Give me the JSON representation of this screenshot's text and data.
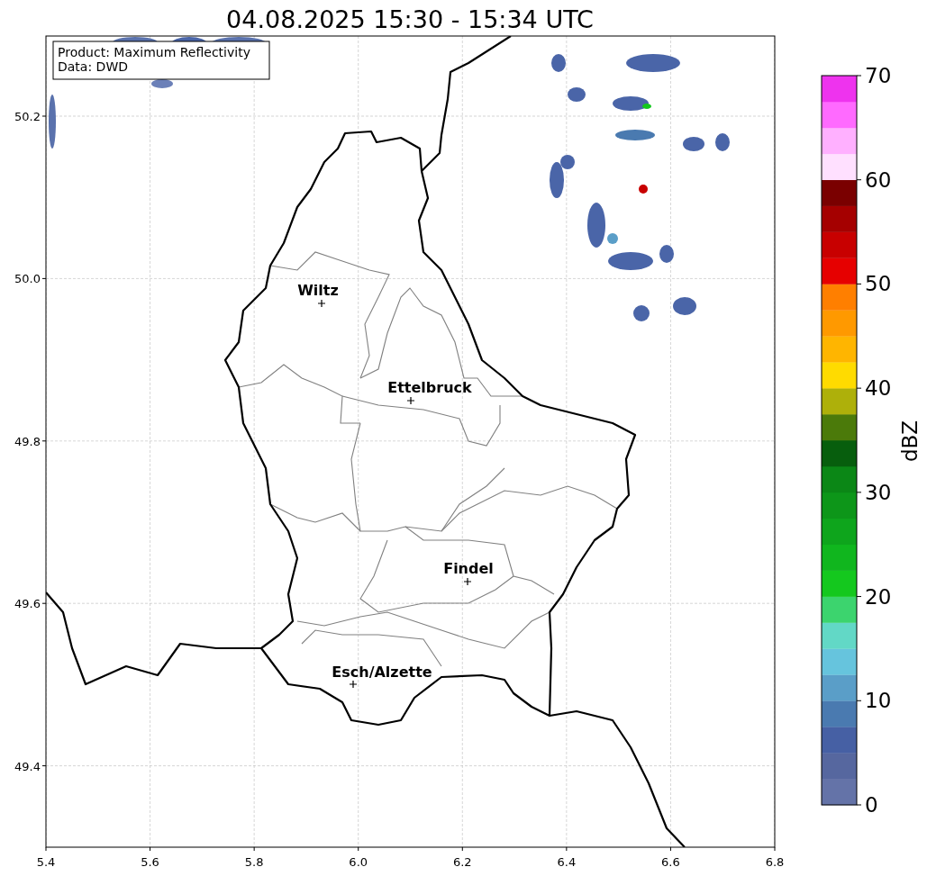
{
  "title": "04.08.2025 15:30 - 15:34 UTC",
  "info_box": [
    "Product: Maximum Reflectivity",
    "Data: DWD"
  ],
  "cities": [
    {
      "name": "Wiltz"
    },
    {
      "name": "Ettelbruck"
    },
    {
      "name": "Findel"
    },
    {
      "name": "Esch/Alzette"
    }
  ],
  "x_ticks": [
    "5.4",
    "5.6",
    "5.8",
    "6.0",
    "6.2",
    "6.4",
    "6.6",
    "6.8"
  ],
  "y_ticks": [
    "50.2",
    "50.0",
    "49.8",
    "49.6",
    "49.4"
  ],
  "colorbar": {
    "label": "dBZ",
    "ticks": [
      "70",
      "60",
      "50",
      "40",
      "30",
      "20",
      "10",
      "0"
    ],
    "bands": [
      {
        "color": "#6473a8"
      },
      {
        "color": "#56679f"
      },
      {
        "color": "#4660a4"
      },
      {
        "color": "#4a7ab0"
      },
      {
        "color": "#5a9ec8"
      },
      {
        "color": "#66c4dd"
      },
      {
        "color": "#62d8c6"
      },
      {
        "color": "#3cd46e"
      },
      {
        "color": "#14c81e"
      },
      {
        "color": "#10b61e"
      },
      {
        "color": "#0ea51c"
      },
      {
        "color": "#0d9619"
      },
      {
        "color": "#0b8716"
      },
      {
        "color": "#075e0d"
      },
      {
        "color": "#4b7a0a"
      },
      {
        "color": "#aeb00a"
      },
      {
        "color": "#ffdb00"
      },
      {
        "color": "#ffb500"
      },
      {
        "color": "#ff9900"
      },
      {
        "color": "#ff7f00"
      },
      {
        "color": "#e60000"
      },
      {
        "color": "#c80000"
      },
      {
        "color": "#a50000"
      },
      {
        "color": "#7a0000"
      },
      {
        "color": "#ffe0ff"
      },
      {
        "color": "#ffb0ff"
      },
      {
        "color": "#ff6aff"
      },
      {
        "color": "#ee33ee"
      }
    ]
  }
}
